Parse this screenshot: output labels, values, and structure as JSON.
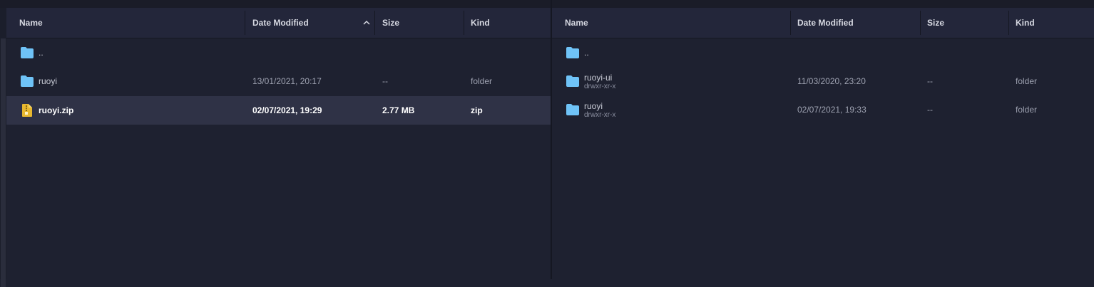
{
  "left_pane": {
    "columns": {
      "name": "Name",
      "date": "Date Modified",
      "size": "Size",
      "kind": "Kind"
    },
    "rows": [
      {
        "name": "..",
        "date": "",
        "size": "",
        "kind": "",
        "icon": "folder-icon"
      },
      {
        "name": "ruoyi",
        "date": "13/01/2021, 20:17",
        "size": "--",
        "kind": "folder",
        "icon": "folder-icon"
      },
      {
        "name": "ruoyi.zip",
        "date": "02/07/2021, 19:29",
        "size": "2.77 MB",
        "kind": "zip",
        "icon": "zip-file-icon",
        "selected": true
      }
    ]
  },
  "right_pane": {
    "columns": {
      "name": "Name",
      "date": "Date Modified",
      "size": "Size",
      "kind": "Kind"
    },
    "rows": [
      {
        "name": "..",
        "perms": "",
        "date": "",
        "size": "",
        "kind": "",
        "icon": "folder-icon"
      },
      {
        "name": "ruoyi-ui",
        "perms": "drwxr-xr-x",
        "date": "11/03/2020, 23:20",
        "size": "--",
        "kind": "folder",
        "icon": "folder-icon"
      },
      {
        "name": "ruoyi",
        "perms": "drwxr-xr-x",
        "date": "02/07/2021, 19:33",
        "size": "--",
        "kind": "folder",
        "icon": "folder-icon"
      }
    ]
  },
  "colors": {
    "folder": "#6fc3f7",
    "zip": "#e8b830",
    "background": "#1e2130",
    "header": "#23263a",
    "selected_row": "#2f3246"
  }
}
